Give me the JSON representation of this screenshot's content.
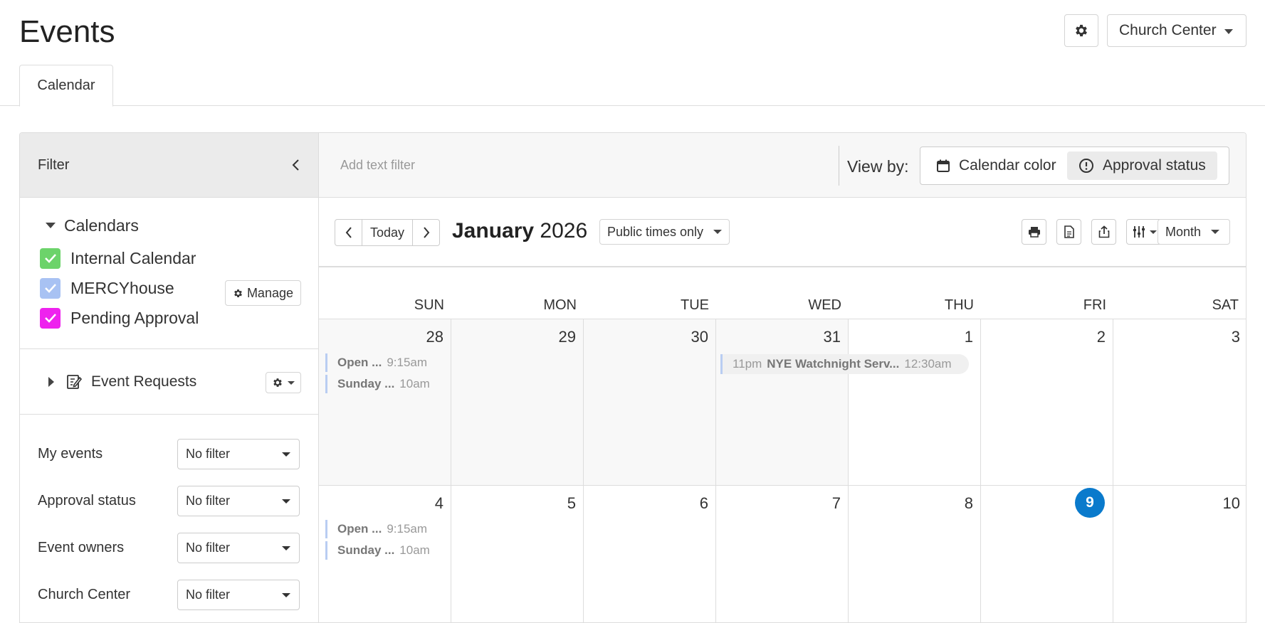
{
  "header": {
    "title": "Events",
    "org_label": "Church Center"
  },
  "tabs": [
    {
      "label": "Calendar"
    }
  ],
  "sidebar": {
    "filter_title": "Filter",
    "calendars_title": "Calendars",
    "manage_label": "Manage",
    "calendars": [
      {
        "label": "Internal Calendar",
        "color": "#6cd36a",
        "checked": true
      },
      {
        "label": "MERCYhouse",
        "color": "#a8c2f3",
        "checked": true
      },
      {
        "label": "Pending Approval",
        "color": "#ee22ee",
        "checked": true
      }
    ],
    "event_requests_label": "Event Requests",
    "filters": [
      {
        "label": "My events",
        "value": "No filter"
      },
      {
        "label": "Approval status",
        "value": "No filter"
      },
      {
        "label": "Event owners",
        "value": "No filter"
      },
      {
        "label": "Church Center",
        "value": "No filter"
      }
    ]
  },
  "toolbar": {
    "text_filter_placeholder": "Add text filter",
    "view_by_label": "View by:",
    "view_options": [
      {
        "label": "Calendar color",
        "icon": "calendar-icon",
        "active": false
      },
      {
        "label": "Approval status",
        "icon": "alert-circle-icon",
        "active": true
      }
    ]
  },
  "nav": {
    "today_label": "Today",
    "month": "January",
    "year": "2026",
    "times_filter": "Public times only",
    "view_select": "Month"
  },
  "calendar": {
    "weekdays": [
      "SUN",
      "MON",
      "TUE",
      "WED",
      "THU",
      "FRI",
      "SAT"
    ],
    "week1": [
      "28",
      "29",
      "30",
      "31",
      "1",
      "2",
      "3"
    ],
    "week2": [
      "4",
      "5",
      "6",
      "7",
      "8",
      "9",
      "10"
    ],
    "today": "9",
    "events_week1_sun": [
      {
        "title": "Open ...",
        "time": "9:15am"
      },
      {
        "title": "Sunday ...",
        "time": "10am"
      }
    ],
    "events_week2_sun": [
      {
        "title": "Open ...",
        "time": "9:15am"
      },
      {
        "title": "Sunday ...",
        "time": "10am"
      }
    ],
    "multi_day_event": {
      "start_time": "11pm",
      "title": "NYE Watchnight Serv...",
      "end_time": "12:30am"
    },
    "event_border_color": "#b9cdf2",
    "today_color": "#0a7acc"
  }
}
